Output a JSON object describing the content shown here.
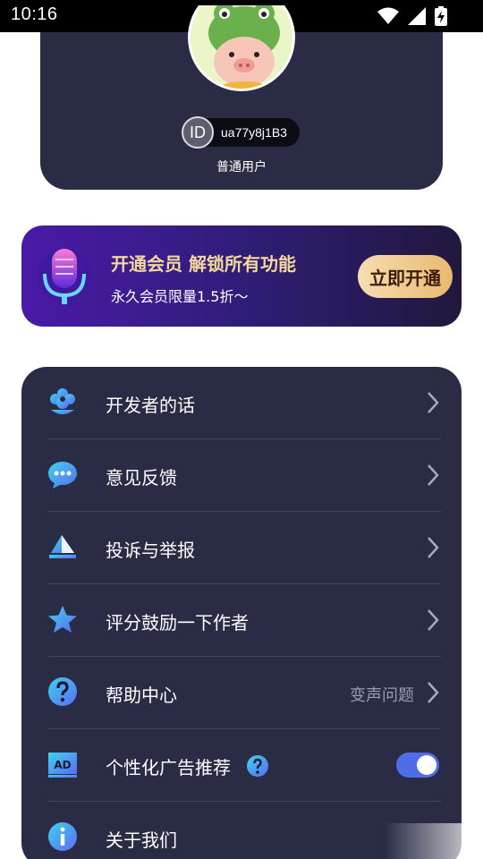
{
  "status_bar": {
    "time": "10:16",
    "icons": [
      "wifi-icon",
      "signal-icon",
      "battery-charging-icon"
    ]
  },
  "profile": {
    "id_badge": "ID",
    "user_id": "ua77y8j1B3",
    "user_type": "普通用户",
    "avatar": "pig-frog-avatar"
  },
  "vip_banner": {
    "title": "开通会员 解锁所有功能",
    "subtitle": "永久会员限量1.5折～",
    "button_label": "立即开通",
    "icon": "microphone-icon"
  },
  "menu": {
    "items": [
      {
        "label": "开发者的话",
        "icon": "flower-icon"
      },
      {
        "label": "意见反馈",
        "icon": "chat-bubble-icon"
      },
      {
        "label": "投诉与举报",
        "icon": "report-icon"
      },
      {
        "label": "评分鼓励一下作者",
        "icon": "star-icon"
      },
      {
        "label": "帮助中心",
        "icon": "question-icon",
        "extra": "变声问题"
      },
      {
        "label": "个性化广告推荐",
        "icon": "ad-icon",
        "toggle_on": true
      },
      {
        "label": "关于我们",
        "icon": "info-icon"
      }
    ]
  },
  "colors": {
    "card_bg": "#2a2b45",
    "accent_blue": "#4f6de6",
    "gold": "#f4d79b",
    "icon_gradient_start": "#3fd2f0",
    "icon_gradient_end": "#5a6cf0"
  }
}
